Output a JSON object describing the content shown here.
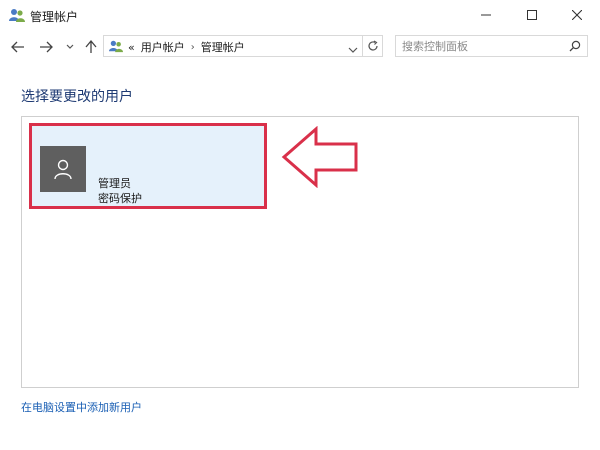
{
  "window": {
    "title": "管理帐户"
  },
  "address_bar": {
    "overflow": "«",
    "crumbs": [
      "用户帐户",
      "管理帐户"
    ]
  },
  "search": {
    "placeholder": "搜索控制面板"
  },
  "main": {
    "heading": "选择要更改的用户",
    "users": [
      {
        "name": "管理员",
        "status": "密码保护"
      }
    ],
    "add_user_link": "在电脑设置中添加新用户"
  },
  "colors": {
    "highlight_border": "#d9304a",
    "tile_bg": "#e5f1fb",
    "heading": "#1e3a73",
    "link": "#1a5fb4"
  },
  "icons": [
    "users-icon",
    "minimize-icon",
    "maximize-icon",
    "close-icon",
    "back-arrow-icon",
    "forward-arrow-icon",
    "recent-dropdown-icon",
    "up-arrow-icon",
    "chevron-down-icon",
    "refresh-icon",
    "search-icon",
    "user-avatar-icon",
    "pointer-arrow-icon"
  ]
}
